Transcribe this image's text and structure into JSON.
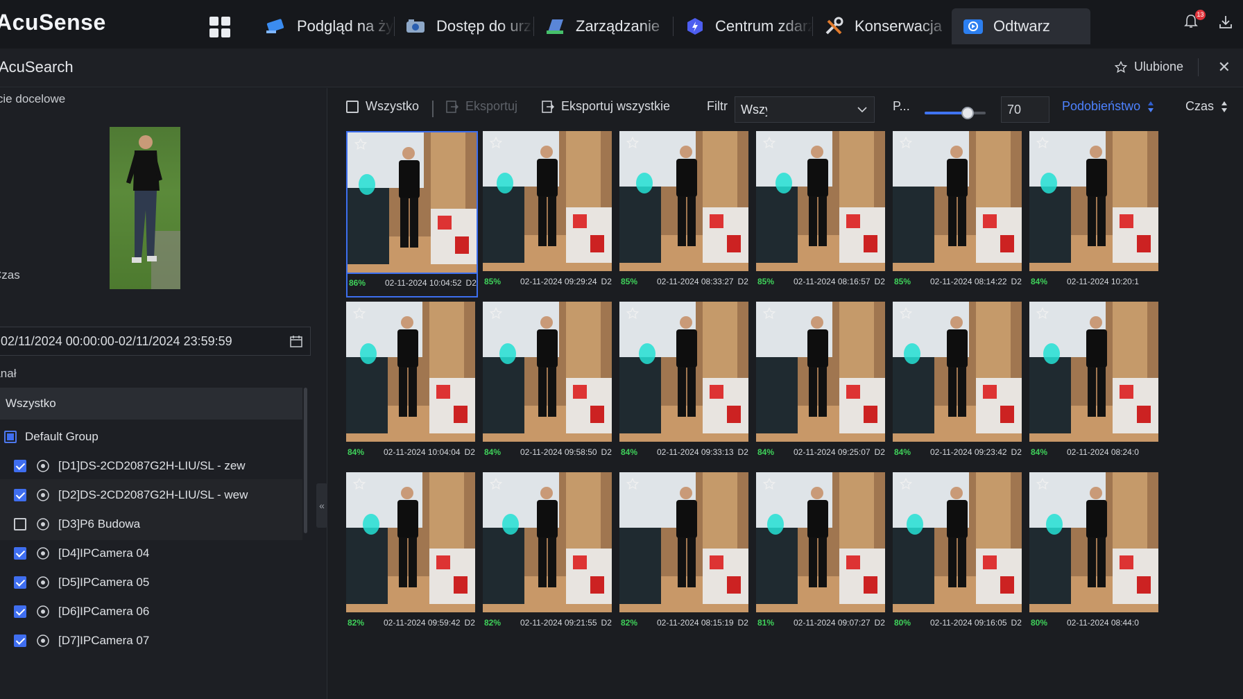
{
  "app": {
    "logo": "AcuSense",
    "notification_count": "13"
  },
  "nav": {
    "tabs": [
      {
        "label": "Podgląd na żywo",
        "icon": "live-view-icon"
      },
      {
        "label": "Dostęp do urządzeń",
        "icon": "camera-access-icon"
      },
      {
        "label": "Zarządzanie",
        "icon": "management-icon"
      },
      {
        "label": "Centrum zdarzeń",
        "icon": "event-center-icon"
      },
      {
        "label": "Konserwacja",
        "icon": "maintenance-icon"
      },
      {
        "label": "Odtwarz",
        "icon": "playback-icon"
      }
    ]
  },
  "subbar": {
    "title": "AcuSearch",
    "favorites_label": "Ulubione",
    "close_glyph": "✕"
  },
  "left": {
    "target_label": "Obiecie docelowe",
    "time_label": "Czas",
    "date_range": "02/11/2024 00:00:00-02/11/2024 23:59:59",
    "channel_label": "Kanał",
    "tree": {
      "all_label": "Wszystko",
      "group_label": "Default Group",
      "cameras": [
        {
          "label": "[D1]DS-2CD2087G2H-LIU/SL - zew",
          "checked": true
        },
        {
          "label": "[D2]DS-2CD2087G2H-LIU/SL - wew",
          "checked": true
        },
        {
          "label": "[D3]P6 Budowa",
          "checked": false
        },
        {
          "label": "[D4]IPCamera 04",
          "checked": true
        },
        {
          "label": "[D5]IPCamera 05",
          "checked": true
        },
        {
          "label": "[D6]IPCamera 06",
          "checked": true
        },
        {
          "label": "[D7]IPCamera 07",
          "checked": true
        }
      ]
    },
    "collapse_glyph": "«"
  },
  "toolbar": {
    "select_all_label": "Wszystko",
    "export_label": "Eksportuj",
    "export_all_label": "Eksportuj wszystkie",
    "filter_label": "Filtr",
    "filter_value": "Wszystko",
    "similarity_short_label": "P...",
    "similarity_level": 0.7,
    "similarity_value": "70",
    "sort_similarity_label": "Podobieństwo",
    "sort_time_label": "Czas"
  },
  "results": [
    {
      "pct": "86%",
      "time": "02-11-2024 10:04:52",
      "ch": "D2"
    },
    {
      "pct": "85%",
      "time": "02-11-2024 09:29:24",
      "ch": "D2"
    },
    {
      "pct": "85%",
      "time": "02-11-2024 08:33:27",
      "ch": "D2"
    },
    {
      "pct": "85%",
      "time": "02-11-2024 08:16:57",
      "ch": "D2"
    },
    {
      "pct": "85%",
      "time": "02-11-2024 08:14:22",
      "ch": "D2"
    },
    {
      "pct": "84%",
      "time": "02-11-2024 10:20:1",
      "ch": ""
    },
    {
      "pct": "84%",
      "time": "02-11-2024 10:04:04",
      "ch": "D2"
    },
    {
      "pct": "84%",
      "time": "02-11-2024 09:58:50",
      "ch": "D2"
    },
    {
      "pct": "84%",
      "time": "02-11-2024 09:33:13",
      "ch": "D2"
    },
    {
      "pct": "84%",
      "time": "02-11-2024 09:25:07",
      "ch": "D2"
    },
    {
      "pct": "84%",
      "time": "02-11-2024 09:23:42",
      "ch": "D2"
    },
    {
      "pct": "84%",
      "time": "02-11-2024 08:24:0",
      "ch": ""
    },
    {
      "pct": "82%",
      "time": "02-11-2024 09:59:42",
      "ch": "D2"
    },
    {
      "pct": "82%",
      "time": "02-11-2024 09:21:55",
      "ch": "D2"
    },
    {
      "pct": "82%",
      "time": "02-11-2024 08:15:19",
      "ch": "D2"
    },
    {
      "pct": "81%",
      "time": "02-11-2024 09:07:27",
      "ch": "D2"
    },
    {
      "pct": "80%",
      "time": "02-11-2024 09:16:05",
      "ch": "D2"
    },
    {
      "pct": "80%",
      "time": "02-11-2024 08:44:0",
      "ch": ""
    }
  ],
  "colors": {
    "accent": "#3f6ef0",
    "similarity_green": "#3fd15a",
    "notification_red": "#e0343b"
  }
}
